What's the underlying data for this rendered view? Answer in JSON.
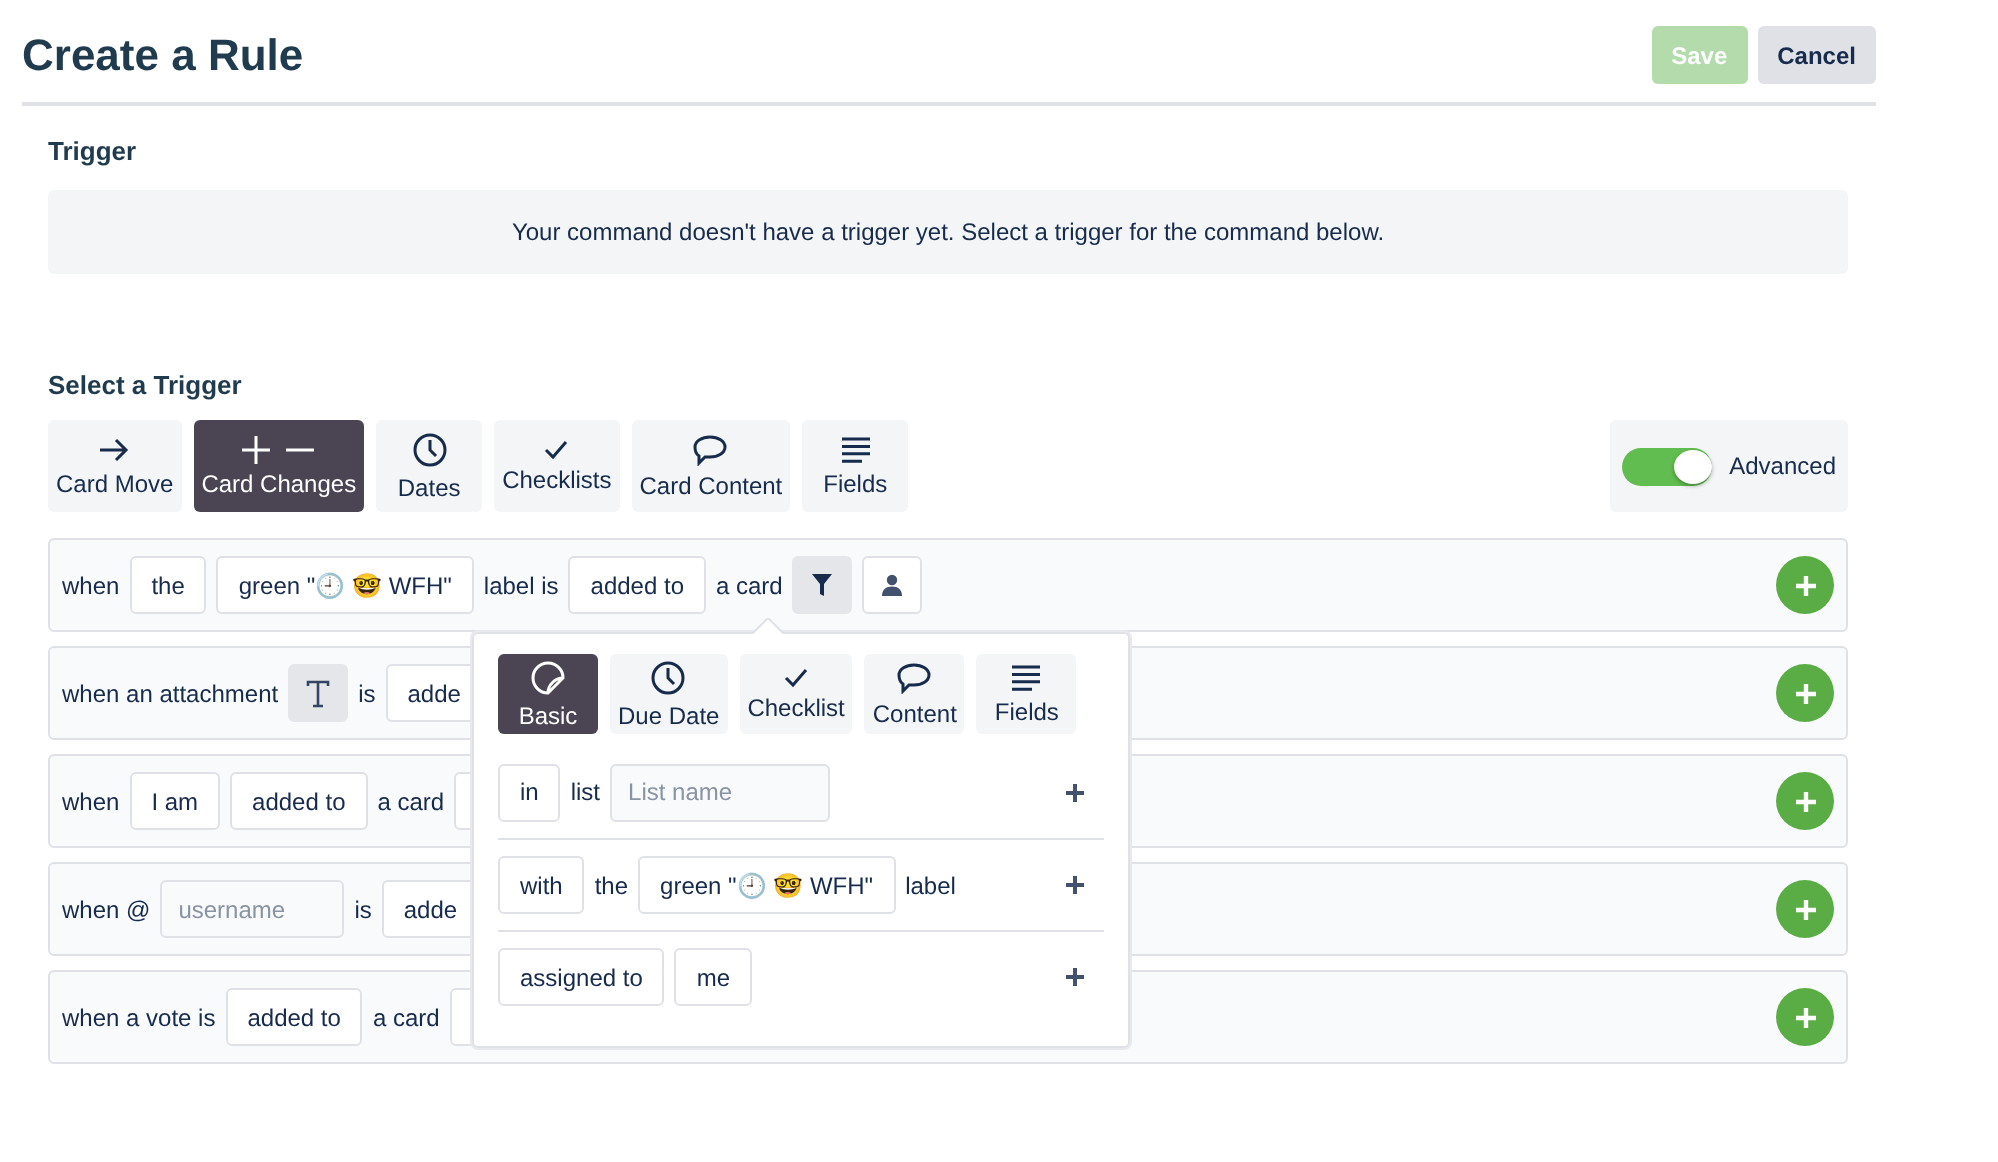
{
  "header": {
    "title": "Create a Rule",
    "buttons": [
      {
        "label": "Save",
        "kind": "primary",
        "disabled": true
      },
      {
        "label": "Cancel",
        "kind": "secondary",
        "disabled": false
      }
    ]
  },
  "trigger": {
    "heading": "Trigger",
    "notice": "Your command doesn't have a trigger yet. Select a trigger for the command below."
  },
  "select_trigger": {
    "heading": "Select a Trigger",
    "tabs": [
      {
        "label": "Card Move",
        "selected": false
      },
      {
        "label": "Card Changes",
        "selected": true
      },
      {
        "label": "Dates",
        "selected": false
      },
      {
        "label": "Checklists",
        "selected": false
      },
      {
        "label": "Card Content",
        "selected": false
      },
      {
        "label": "Fields",
        "selected": false
      }
    ],
    "advanced": {
      "label": "Advanced",
      "on": true
    }
  },
  "rules": [
    {
      "tokens": [
        {
          "kind": "text",
          "text": "when"
        },
        {
          "kind": "chip",
          "text": "the"
        },
        {
          "kind": "chip",
          "text": "green \"🕘 🤓 WFH\""
        },
        {
          "kind": "text",
          "text": "label is"
        },
        {
          "kind": "chip",
          "text": "added to"
        },
        {
          "kind": "text",
          "text": "a card"
        },
        {
          "kind": "filter",
          "selected": true
        },
        {
          "kind": "person",
          "selected": false
        }
      ]
    },
    {
      "tokens": [
        {
          "kind": "text",
          "text": "when an attachment"
        },
        {
          "kind": "text-icon"
        },
        {
          "kind": "text",
          "text": "is"
        },
        {
          "kind": "chip",
          "text": "adde"
        }
      ]
    },
    {
      "tokens": [
        {
          "kind": "text",
          "text": "when"
        },
        {
          "kind": "chip",
          "text": "I am"
        },
        {
          "kind": "chip",
          "text": "added to"
        },
        {
          "kind": "text",
          "text": "a card"
        },
        {
          "kind": "stub"
        }
      ]
    },
    {
      "tokens": [
        {
          "kind": "text",
          "text": "when @"
        },
        {
          "kind": "field",
          "placeholder": "username"
        },
        {
          "kind": "text",
          "text": "is"
        },
        {
          "kind": "chip",
          "text": "adde"
        }
      ]
    },
    {
      "tokens": [
        {
          "kind": "text",
          "text": "when a vote is"
        },
        {
          "kind": "chip",
          "text": "added to"
        },
        {
          "kind": "text",
          "text": "a card"
        },
        {
          "kind": "stub"
        }
      ]
    }
  ],
  "filter_popover": {
    "tabs": [
      {
        "label": "Basic",
        "selected": true
      },
      {
        "label": "Due Date",
        "selected": false
      },
      {
        "label": "Checklist",
        "selected": false
      },
      {
        "label": "Content",
        "selected": false
      },
      {
        "label": "Fields",
        "selected": false
      }
    ],
    "rows": [
      {
        "tokens": [
          {
            "kind": "chip",
            "text": "in"
          },
          {
            "kind": "text",
            "text": "list"
          },
          {
            "kind": "field",
            "placeholder": "List name"
          }
        ]
      },
      {
        "tokens": [
          {
            "kind": "chip",
            "text": "with"
          },
          {
            "kind": "text",
            "text": "the"
          },
          {
            "kind": "chip",
            "text": "green \"🕘 🤓 WFH\""
          },
          {
            "kind": "text",
            "text": "label"
          }
        ]
      },
      {
        "tokens": [
          {
            "kind": "chip",
            "text": "assigned to"
          },
          {
            "kind": "chip",
            "text": "me"
          }
        ]
      }
    ]
  }
}
